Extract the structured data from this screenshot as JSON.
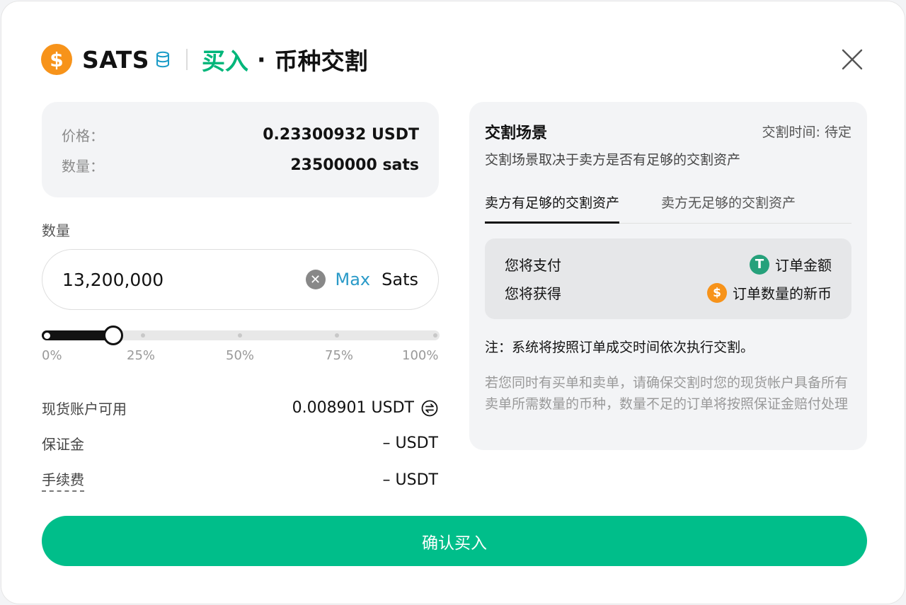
{
  "header": {
    "coin_symbol_glyph": "$",
    "coin": "SATS",
    "action": "买入",
    "separator": "·",
    "title": "币种交割",
    "coin_icon": "sats-coin-icon",
    "close_icon": "close-icon"
  },
  "order_info": {
    "price_label": "价格：",
    "price_value": "0.23300932 USDT",
    "qty_label": "数量：",
    "qty_value": "23500000 sats"
  },
  "quantity": {
    "label": "数量",
    "value": "13,200,000",
    "max_label": "Max",
    "unit": "Sats",
    "clear_glyph": "✕",
    "slider_percent": 18,
    "tick_labels": [
      "0%",
      "25%",
      "50%",
      "75%",
      "100%"
    ]
  },
  "account": {
    "available_label": "现货账户可用",
    "available_value": "0.008901 USDT",
    "margin_label": "保证金",
    "margin_value": "– USDT",
    "fee_label": "手续费",
    "fee_value": "– USDT"
  },
  "delivery": {
    "title": "交割场景",
    "time_text": "交割时间: 待定",
    "subtitle": "交割场景取决于卖方是否有足够的交割资产",
    "tabs": [
      {
        "label": "卖方有足够的交割资产",
        "active": true
      },
      {
        "label": "卖方无足够的交割资产",
        "active": false
      }
    ],
    "pay_label": "您将支付",
    "pay_value": "订单金额",
    "pay_icon_glyph": "T",
    "receive_label": "您将获得",
    "receive_value": "订单数量的新币",
    "receive_icon_glyph": "$",
    "note1": "注：系统将按照订单成交时间依次执行交割。",
    "note2": "若您同时有买单和卖单，请确保交割时您的现货帐户具备所有卖单所需数量的币种，数量不足的订单将按照保证金赔付处理"
  },
  "confirm_label": "确认买入",
  "colors": {
    "accent_green": "#00be8a",
    "buy_text_green": "#00b67a",
    "max_blue": "#2a9ac8",
    "sats_orange": "#f7931a",
    "tether_green": "#26a17b"
  }
}
